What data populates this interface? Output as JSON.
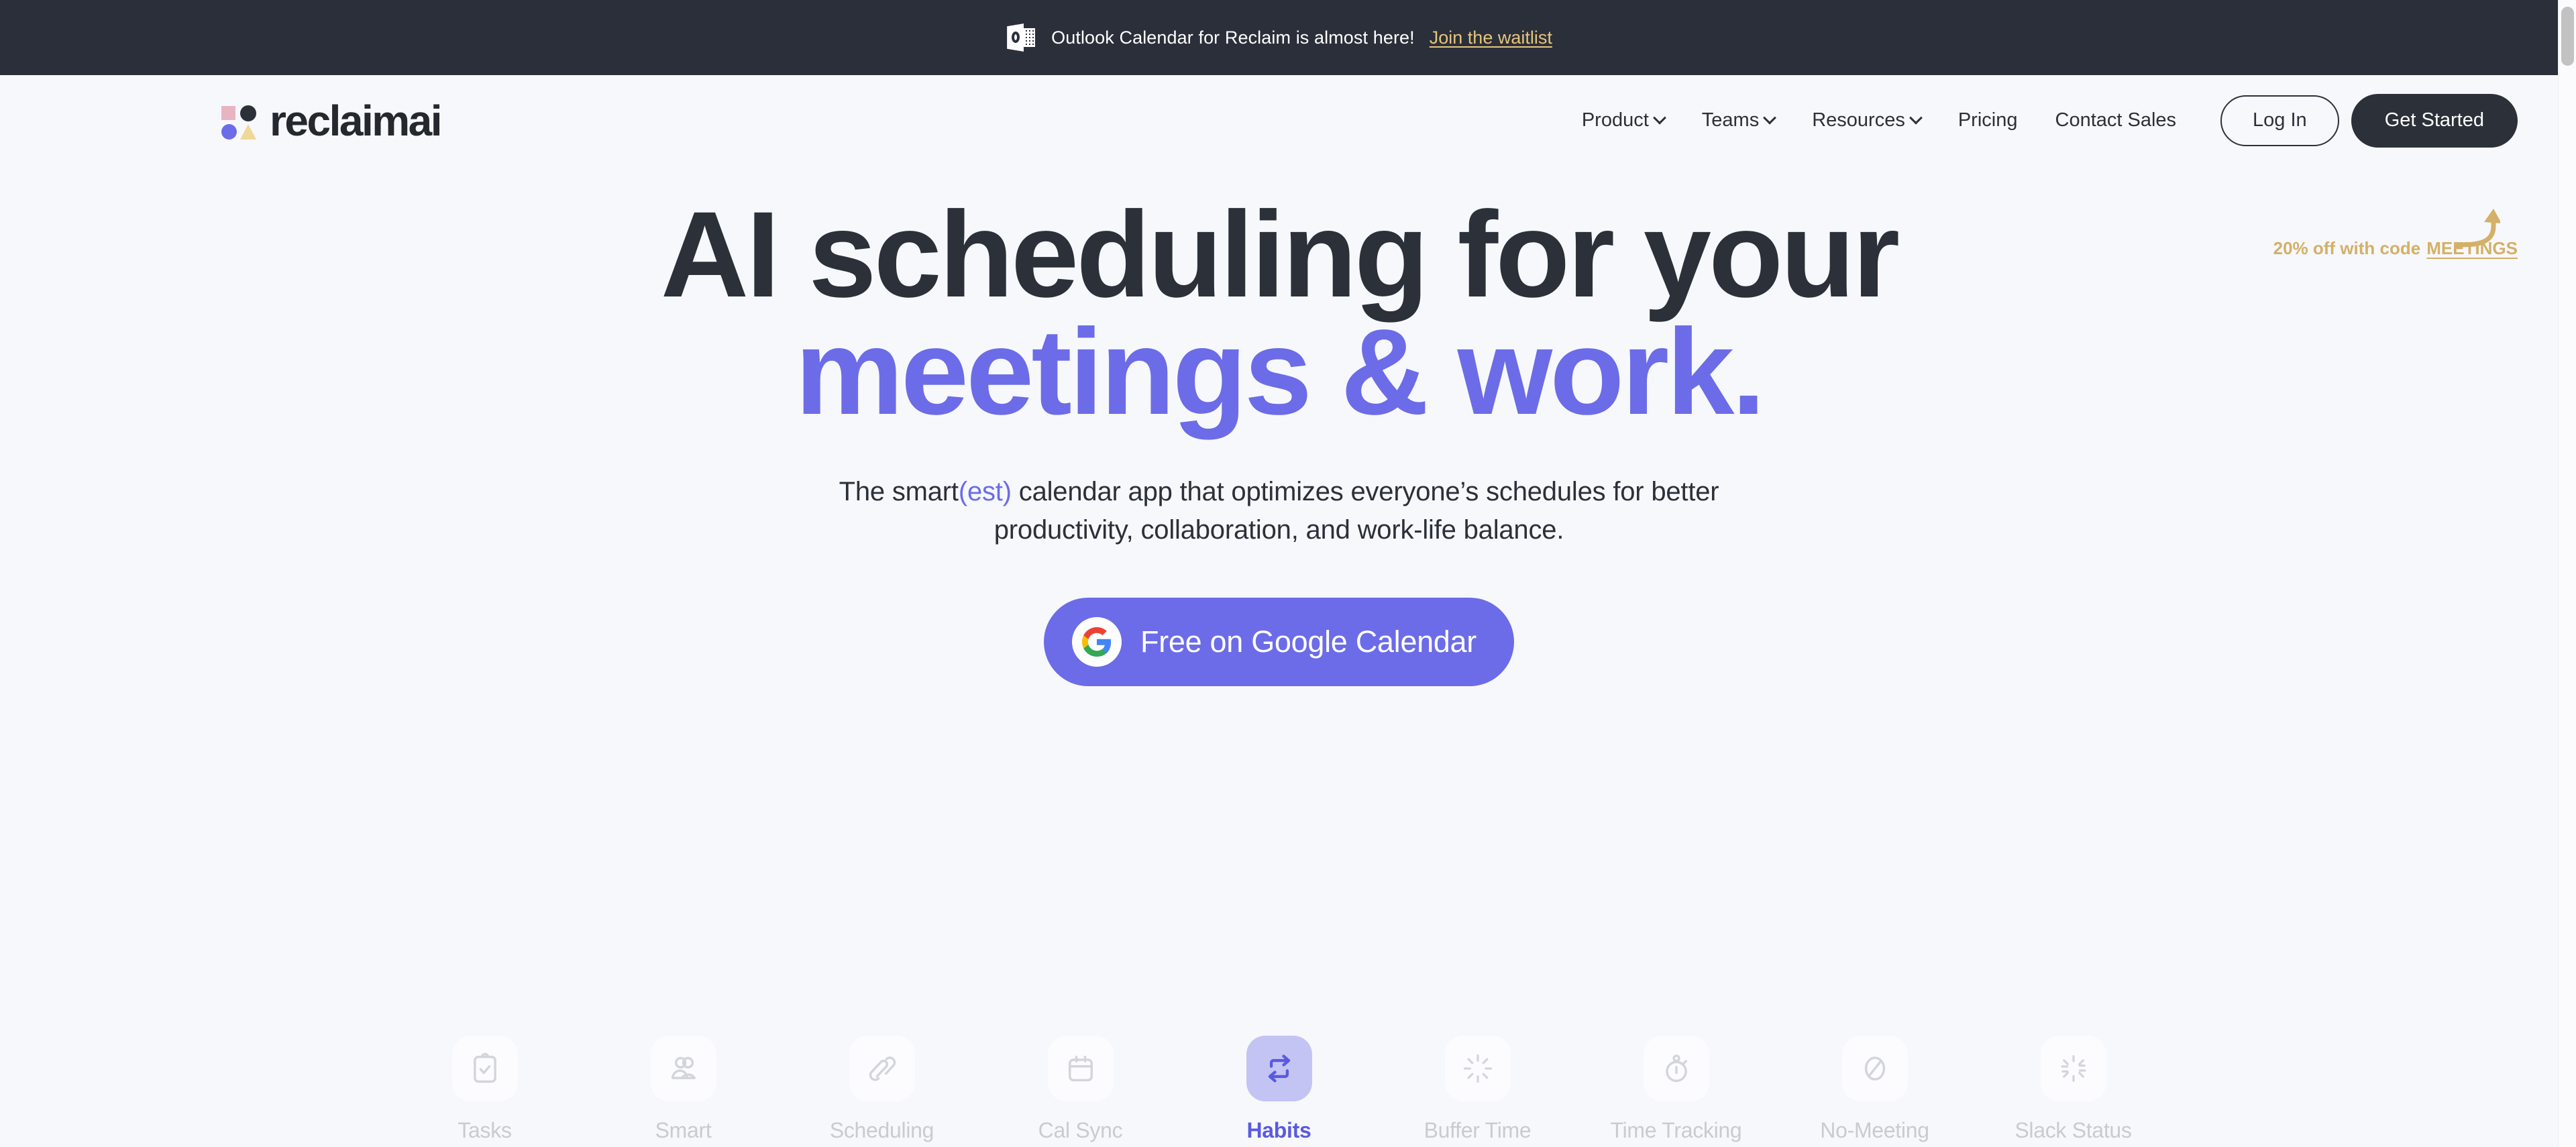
{
  "announcement": {
    "icon": "outlook-icon",
    "text": "Outlook Calendar for Reclaim is almost here!",
    "link_label": "Join the waitlist",
    "background": "#2b2f3a",
    "link_color": "#e5c57c"
  },
  "header": {
    "logo_text": "reclaimai",
    "nav": [
      {
        "label": "Product",
        "has_dropdown": true
      },
      {
        "label": "Teams",
        "has_dropdown": true
      },
      {
        "label": "Resources",
        "has_dropdown": true
      },
      {
        "label": "Pricing",
        "has_dropdown": false
      },
      {
        "label": "Contact Sales",
        "has_dropdown": false
      }
    ],
    "login_label": "Log In",
    "get_started_label": "Get Started",
    "promo_text": "20% off with code",
    "promo_code": "MEETINGS",
    "promo_color": "#d4b068"
  },
  "hero": {
    "headline_line1": "AI scheduling for your",
    "headline_line2_a": "meetings",
    "headline_line2_b": " & ",
    "headline_line2_c": "work.",
    "subtitle_a": "The smart",
    "subtitle_est": "(est)",
    "subtitle_b": " calendar app that optimizes everyone’s schedules for better",
    "subtitle_c": "productivity, collaboration, and work-life balance.",
    "cta_label": "Free on Google Calendar",
    "accent_color": "#6c6ce8",
    "text_color": "#2b3039"
  },
  "features": [
    {
      "label": "Tasks",
      "icon": "clipboard-check-icon",
      "active": false
    },
    {
      "label": "Smart",
      "icon": "people-icon",
      "active": false
    },
    {
      "label": "Scheduling",
      "icon": "link-icon",
      "active": false
    },
    {
      "label": "Cal Sync",
      "icon": "calendar-icon",
      "active": false
    },
    {
      "label": "Habits",
      "icon": "repeat-icon",
      "active": true
    },
    {
      "label": "Buffer Time",
      "icon": "burst-icon",
      "active": false
    },
    {
      "label": "Time Tracking",
      "icon": "stopwatch-icon",
      "active": false
    },
    {
      "label": "No-Meeting",
      "icon": "no-entry-icon",
      "active": false
    },
    {
      "label": "Slack Status",
      "icon": "slack-burst-icon",
      "active": false
    }
  ],
  "page": {
    "background": "#f7f8fc"
  }
}
